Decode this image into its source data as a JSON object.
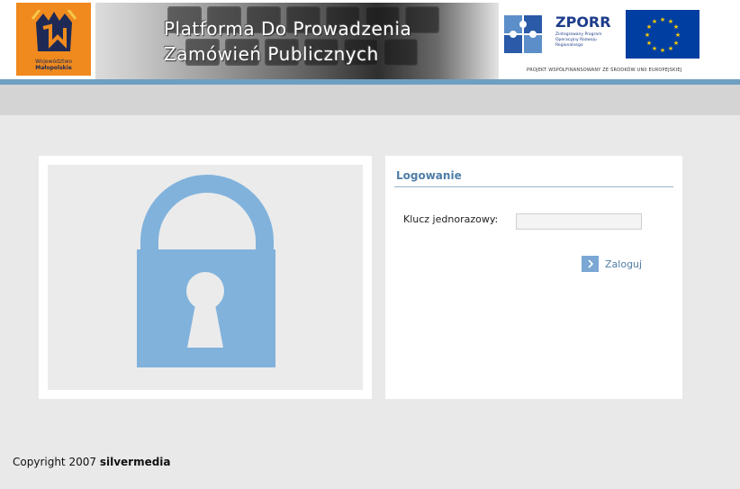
{
  "header": {
    "logo_line1": "Województwo",
    "logo_line2": "Małopolskie",
    "banner_title_line1": "Platforma Do Prowadzenia",
    "banner_title_line2": "Zamówień Publicznych",
    "zporr_title": "ZPORR",
    "zporr_subtitle": "Zintegrowany Program Operacyjny Rozwoju Regionalnego",
    "project_text": "PROJEKT WSPÓŁFINANSOWANY ZE ŚRODKÓW UNII EUROPEJSKIEJ"
  },
  "login": {
    "title": "Logowanie",
    "key_label": "Klucz jednorazowy:",
    "key_value": "",
    "button_label": "Zaloguj"
  },
  "footer": {
    "copyright": "Copyright 2007",
    "brand": "silvermedia"
  },
  "colors": {
    "accent": "#4f7ea7",
    "lock": "#80b2dc",
    "logo_orange": "#f08a1e",
    "eu_blue": "#003ea1"
  }
}
